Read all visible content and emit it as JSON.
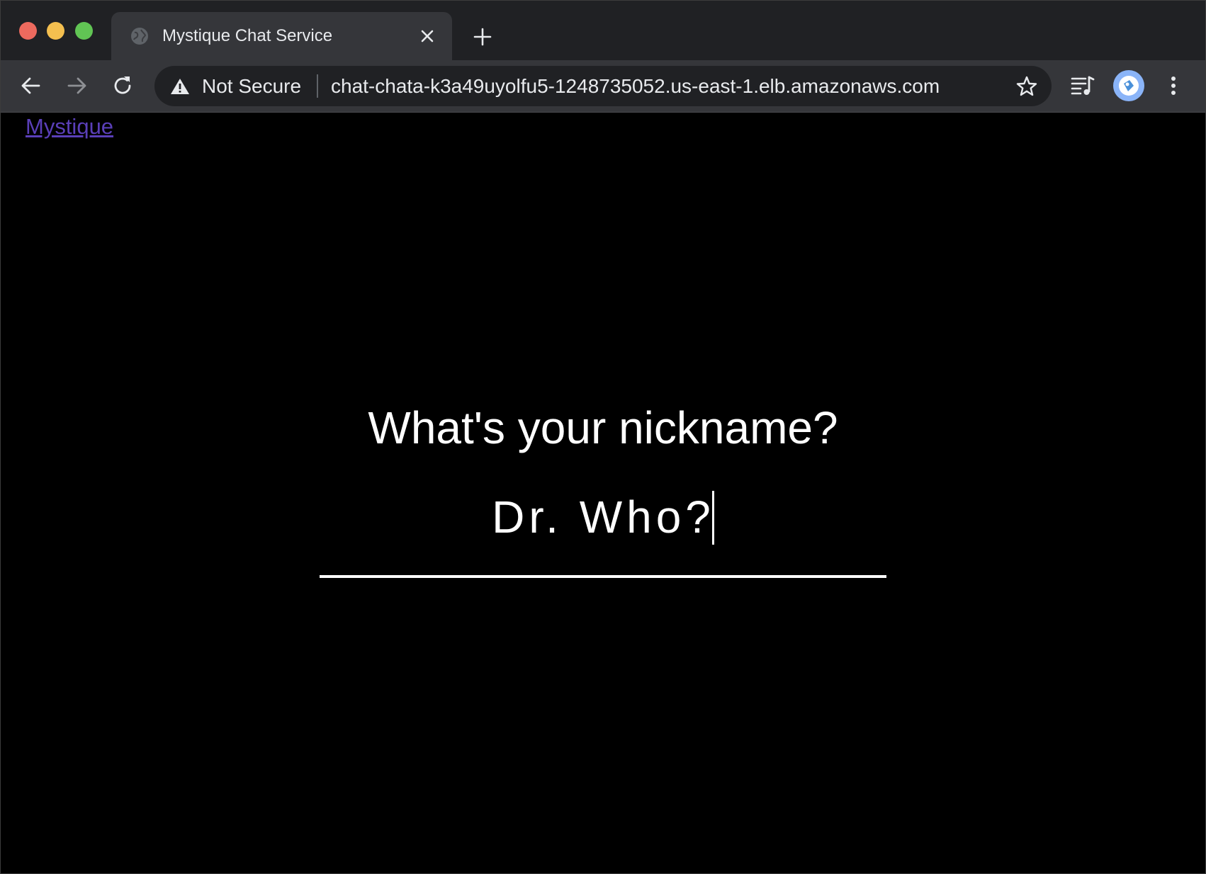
{
  "browser": {
    "tabs": [
      {
        "title": "Mystique Chat Service",
        "favicon": "globe-icon",
        "active": true
      }
    ],
    "new_tab_icon": "plus-icon",
    "security_label": "Not Secure",
    "url": "chat-chata-k3a49uyolfu5-1248735052.us-east-1.elb.amazonaws.com",
    "icons": {
      "back": "arrow-left-icon",
      "forward": "arrow-right-icon",
      "reload": "reload-icon",
      "warning": "warning-triangle-icon",
      "bookmark": "star-icon",
      "media": "media-control-icon",
      "profile": "avatar",
      "menu": "kebab-menu-icon"
    }
  },
  "page": {
    "brand_link": "Mystique",
    "prompt": "What's your nickname?",
    "nickname_value": "Dr. Who?"
  },
  "colors": {
    "page_background": "#000000",
    "text": "#ffffff",
    "link": "#5a3fb8",
    "tab_strip": "#202124",
    "toolbar": "#35363a",
    "avatar": "#8ab4f8"
  }
}
